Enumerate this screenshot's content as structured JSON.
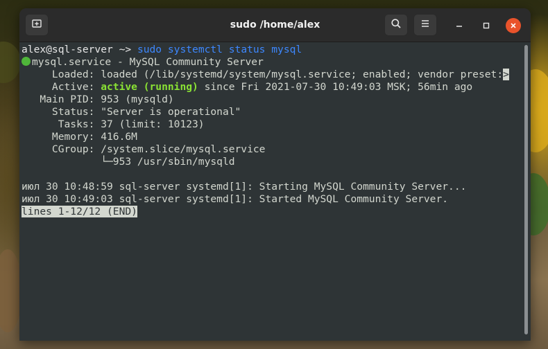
{
  "window": {
    "title": "sudo /home/alex",
    "new_tab_icon": "new-tab-icon",
    "search_icon": "search-icon",
    "menu_icon": "hamburger-menu-icon"
  },
  "terminal": {
    "prompt_user": "alex@sql-server",
    "prompt_path": " ~> ",
    "command": "sudo systemctl status mysql",
    "service_line": "mysql.service - MySQL Community Server",
    "loaded": "     Loaded: loaded (/lib/systemd/system/mysql.service; enabled; vendor preset:",
    "loaded_more": ">",
    "active_label": "     Active: ",
    "active_state": "active (running)",
    "active_rest": " since Fri 2021-07-30 10:49:03 MSK; 56min ago",
    "main_pid": "   Main PID: 953 (mysqld)",
    "status": "     Status: \"Server is operational\"",
    "tasks": "      Tasks: 37 (limit: 10123)",
    "memory": "     Memory: 416.6M",
    "cgroup": "     CGroup: /system.slice/mysql.service",
    "cgroup_child": "             └─953 /usr/sbin/mysqld",
    "log1": "июл 30 10:48:59 sql-server systemd[1]: Starting MySQL Community Server...",
    "log2": "июл 30 10:49:03 sql-server systemd[1]: Started MySQL Community Server.",
    "pager_status": "lines 1-12/12 (END)"
  },
  "colors": {
    "running": "#8ae234",
    "command": "#3d88ff",
    "close": "#e9532b",
    "terminal_bg": "#2e3436"
  }
}
